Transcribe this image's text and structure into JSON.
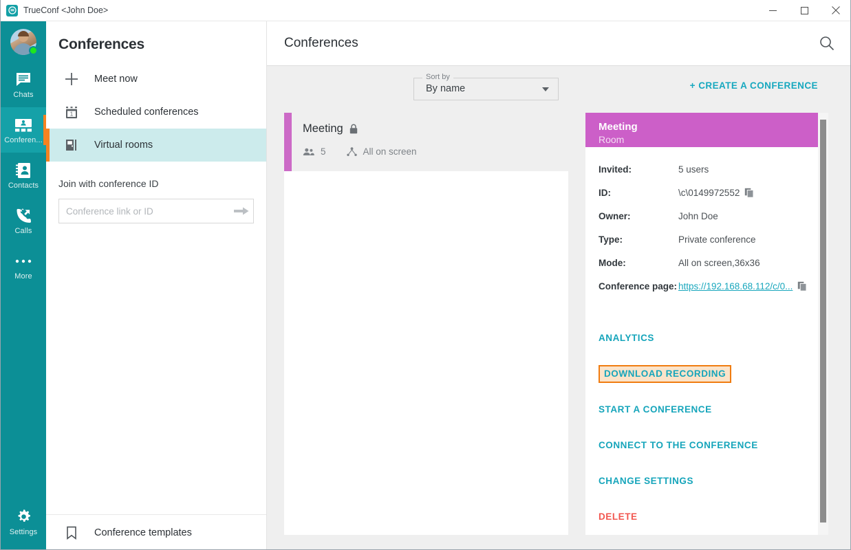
{
  "window": {
    "title": "TrueConf <John Doe>",
    "logo_icon": "trueconf-logo-icon",
    "minimize_icon": "minimize-icon",
    "maximize_icon": "maximize-icon",
    "close_icon": "close-icon"
  },
  "rail": {
    "avatar_name": "user-avatar",
    "status": "online",
    "items": [
      {
        "label": "Chats",
        "icon": "chat-bubble-icon",
        "active": false
      },
      {
        "label": "Conferen...",
        "icon": "conference-people-icon",
        "active": true
      },
      {
        "label": "Contacts",
        "icon": "contacts-card-icon",
        "active": false
      },
      {
        "label": "Calls",
        "icon": "phone-call-icon",
        "active": false
      },
      {
        "label": "More",
        "icon": "ellipsis-icon",
        "active": false
      }
    ],
    "settings": {
      "label": "Settings",
      "icon": "gear-icon"
    }
  },
  "panel": {
    "title": "Conferences",
    "menu": [
      {
        "label": "Meet now",
        "icon": "plus-icon",
        "active": false
      },
      {
        "label": "Scheduled conferences",
        "icon": "calendar-icon",
        "active": false
      },
      {
        "label": "Virtual rooms",
        "icon": "door-room-icon",
        "active": true
      }
    ],
    "join_label": "Join with conference ID",
    "join_placeholder": "Conference link or ID",
    "join_value": "",
    "join_arrow_icon": "arrow-right-icon",
    "templates": {
      "label": "Conference templates",
      "icon": "bookmark-icon"
    }
  },
  "main": {
    "header_title": "Conferences",
    "search_icon": "search-icon",
    "toolbar": {
      "sort_legend": "Sort by",
      "sort_value": "By name",
      "sort_caret_icon": "chevron-down-icon",
      "create_label": "+ CREATE A CONFERENCE"
    }
  },
  "conference_card": {
    "name": "Meeting",
    "lock_icon": "lock-icon",
    "participants_icon": "people-icon",
    "participants_count": "5",
    "mode_icon": "all-on-screen-icon",
    "mode_label": "All on screen",
    "stripe_color": "#cc6ac7"
  },
  "detail": {
    "header_title": "Meeting",
    "header_subtitle": "Room",
    "header_color": "#cc5fc8",
    "rows": [
      {
        "label": "Invited:",
        "value": "5 users",
        "copy": false
      },
      {
        "label": "ID:",
        "value": "\\c\\0149972552",
        "copy": true
      },
      {
        "label": "Owner:",
        "value": "John Doe",
        "copy": false
      },
      {
        "label": "Type:",
        "value": "Private conference",
        "copy": false
      },
      {
        "label": "Mode:",
        "value": "All on screen,36x36",
        "copy": false
      }
    ],
    "conference_page": {
      "label": "Conference page:",
      "url_text": "https://192.168.68.112/c/0...",
      "copy_icon": "copy-icon"
    },
    "actions": [
      {
        "label": "ANALYTICS",
        "style": "link"
      },
      {
        "label": "DOWNLOAD RECORDING",
        "style": "highlighted"
      },
      {
        "label": "START A CONFERENCE",
        "style": "link"
      },
      {
        "label": "CONNECT TO THE CONFERENCE",
        "style": "link"
      },
      {
        "label": "CHANGE SETTINGS",
        "style": "link"
      },
      {
        "label": "DELETE",
        "style": "danger"
      }
    ],
    "colors": {
      "link": "#16a5bb",
      "danger": "#f2564f",
      "highlight_border": "#f07c10",
      "highlight_bg": "#fbe3c9"
    }
  }
}
